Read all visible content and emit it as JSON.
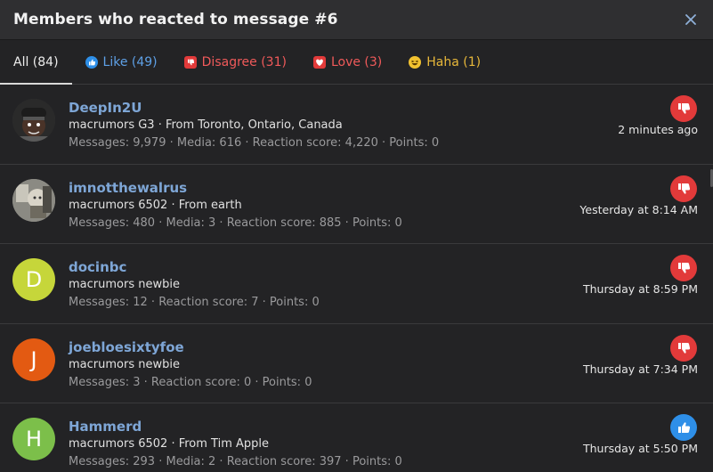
{
  "dialog": {
    "title": "Members who reacted to message #6"
  },
  "tabs": [
    {
      "label": "All (84)",
      "type": "all"
    },
    {
      "label": "Like (49)",
      "type": "like"
    },
    {
      "label": "Disagree (31)",
      "type": "disagree"
    },
    {
      "label": "Love (3)",
      "type": "love"
    },
    {
      "label": "Haha (1)",
      "type": "haha"
    }
  ],
  "members": [
    {
      "name": "DeepIn2U",
      "title": "macrumors G3 · From Toronto, Ontario, Canada",
      "stats": "Messages: 9,979 · Media: 616 · Reaction score: 4,220 · Points: 0",
      "time": "2 minutes ago",
      "reaction": "disagree",
      "avatar": {
        "type": "photo",
        "letter": "",
        "color": "#3a3a3a"
      }
    },
    {
      "name": "imnotthewalrus",
      "title": "macrumors 6502 · From earth",
      "stats": "Messages: 480 · Media: 3 · Reaction score: 885 · Points: 0",
      "time": "Yesterday at 8:14 AM",
      "reaction": "disagree",
      "avatar": {
        "type": "photo",
        "letter": "",
        "color": "#8a8a84"
      }
    },
    {
      "name": "docinbc",
      "title": "macrumors newbie",
      "stats": "Messages: 12 · Reaction score: 7 · Points: 0",
      "time": "Thursday at 8:59 PM",
      "reaction": "disagree",
      "avatar": {
        "type": "letter",
        "letter": "D",
        "color": "#c6d63a"
      }
    },
    {
      "name": "joebloesixtyfoe",
      "title": "macrumors newbie",
      "stats": "Messages: 3 · Reaction score: 0 · Points: 0",
      "time": "Thursday at 7:34 PM",
      "reaction": "disagree",
      "avatar": {
        "type": "letter",
        "letter": "J",
        "color": "#e35a12"
      }
    },
    {
      "name": "Hammerd",
      "title": "macrumors 6502 · From Tim Apple",
      "stats": "Messages: 293 · Media: 2 · Reaction score: 397 · Points: 0",
      "time": "Thursday at 5:50 PM",
      "reaction": "like",
      "avatar": {
        "type": "letter",
        "letter": "H",
        "color": "#7cbf4a"
      }
    }
  ],
  "colors": {
    "background": "#232325",
    "header": "#2f2f31",
    "username": "#7ea6d6",
    "like": "#2e8fe8",
    "disagree": "#e23a3a",
    "haha": "#e8b83a"
  }
}
